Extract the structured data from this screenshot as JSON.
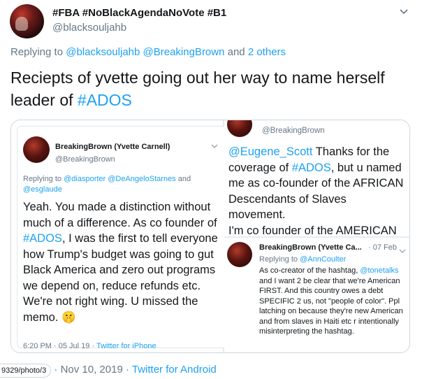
{
  "author": {
    "display_name": "#FBA #NoBlackAgendaNoVote #B1",
    "handle": "@blacksouljahb"
  },
  "reply": {
    "prefix": "Replying to",
    "handles": "@blacksouljahb @BreakingBrown",
    "and": "and",
    "others": "2 others"
  },
  "tweet": {
    "text_plain": "Reciepts of yvette going out her way to name herself leader of ",
    "hashtag": "#ADOS"
  },
  "photo1": {
    "name": "BreakingBrown (Yvette Carnell)",
    "handle": "@BreakingBrown",
    "reply_prefix": "Replying to",
    "reply_handles_1": "@diasporter @DeAngeloStarnes",
    "reply_and": "and",
    "reply_handles_2": "@esglaude",
    "text_1": "Yeah. You made a distinction without much of a difference. As co founder of ",
    "hashtag": "#ADOS",
    "text_2": ", I was the first to tell everyone how Trump's budget was going to gut Black America and zero out programs we depend on, reduce refunds etc. We're not right wing. U missed the memo. 🤫",
    "time": "6:20 PM · 05 Jul 19 · ",
    "source": "Twitter for iPhone"
  },
  "photo2": {
    "handle": "@BreakingBrown",
    "mention": "@Eugene_Scott",
    "text_1": " Thanks for the coverage of ",
    "hashtag": "#ADOS",
    "text_2": ", but u named me as co-founder of the AFRICAN Descendants of Slaves movement.",
    "text_3": "I'm co founder of the AMERICAN"
  },
  "photo3": {
    "name": "BreakingBrown (Yvette Ca...",
    "date": "· 07 Feb",
    "reply_prefix": "Replying to",
    "reply_handle": "@AnnCoulter",
    "text_1": "As co-creator of the hashtag, ",
    "mention": "@tonetalks",
    "text_2": " and I want 2 be clear that we're American FIRST. And this country owes a debt SPECIFIC 2 us, not \"people of color\". Ppl latching on because they're new American and from slaves in Haiti etc r intentionally misinterpreting the hashtag."
  },
  "footer": {
    "url_fragment": "9329/photo/3",
    "date": "· Nov 10, 2019 · ",
    "source": "Twitter for Android"
  },
  "icons": {
    "caret": "chevron-down-icon"
  },
  "colors": {
    "link": "#1da1f2",
    "secondary_text": "#657786",
    "border": "#ccd6dd"
  }
}
